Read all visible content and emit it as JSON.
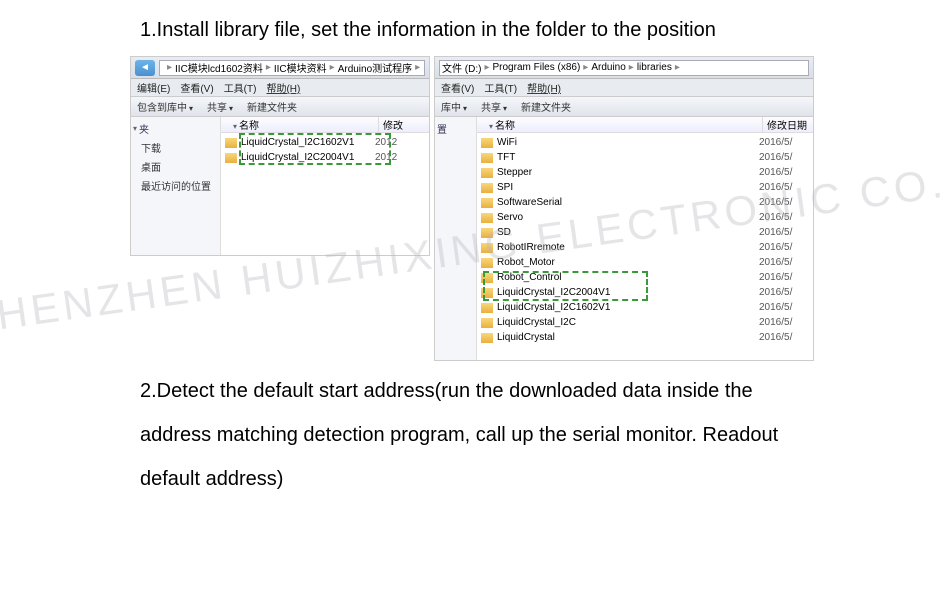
{
  "watermark": "SHENZHEN HUIZHIXING ELECTRONIC CO.,LTD",
  "instructions": {
    "step1": "1.Install library file, set the information in the folder to the position",
    "step2": "2.Detect the default start address(run the downloaded data inside the address matching detection program, call up the serial monitor. Readout default address)"
  },
  "left_window": {
    "breadcrumb": [
      "IIC模块lcd1602资料",
      "IIC模块资料",
      "Arduino测试程序"
    ],
    "menu": {
      "edit": "编辑(E)",
      "view": "查看(V)",
      "tools": "工具(T)",
      "help": "帮助(H)"
    },
    "toolbar": {
      "library": "包含到库中",
      "share": "共享",
      "newfolder": "新建文件夹"
    },
    "sidebar": {
      "section": "夹",
      "items": [
        "下载",
        "桌面",
        "最近访问的位置"
      ]
    },
    "columns": {
      "name": "名称",
      "date": "修改"
    },
    "files": [
      {
        "name": "LiquidCrystal_I2C1602V1",
        "date": "2012"
      },
      {
        "name": "LiquidCrystal_I2C2004V1",
        "date": "2012"
      }
    ]
  },
  "right_window": {
    "breadcrumb_prefix": "文件 (D:)",
    "breadcrumb": [
      "Program Files (x86)",
      "Arduino",
      "libraries"
    ],
    "menu": {
      "view": "查看(V)",
      "tools": "工具(T)",
      "help": "帮助(H)"
    },
    "toolbar": {
      "library": "库中",
      "share": "共享",
      "newfolder": "新建文件夹"
    },
    "sidebar": {
      "section": "置"
    },
    "columns": {
      "name": "名称",
      "date": "修改日期"
    },
    "files": [
      {
        "name": "WiFi",
        "date": "2016/5/"
      },
      {
        "name": "TFT",
        "date": "2016/5/"
      },
      {
        "name": "Stepper",
        "date": "2016/5/"
      },
      {
        "name": "SPI",
        "date": "2016/5/"
      },
      {
        "name": "SoftwareSerial",
        "date": "2016/5/"
      },
      {
        "name": "Servo",
        "date": "2016/5/"
      },
      {
        "name": "SD",
        "date": "2016/5/"
      },
      {
        "name": "RobotIRremote",
        "date": "2016/5/"
      },
      {
        "name": "Robot_Motor",
        "date": "2016/5/"
      },
      {
        "name": "Robot_Control",
        "date": "2016/5/"
      },
      {
        "name": "LiquidCrystal_I2C2004V1",
        "date": "2016/5/"
      },
      {
        "name": "LiquidCrystal_I2C1602V1",
        "date": "2016/5/"
      },
      {
        "name": "LiquidCrystal_I2C",
        "date": "2016/5/"
      },
      {
        "name": "LiquidCrystal",
        "date": "2016/5/"
      }
    ]
  }
}
